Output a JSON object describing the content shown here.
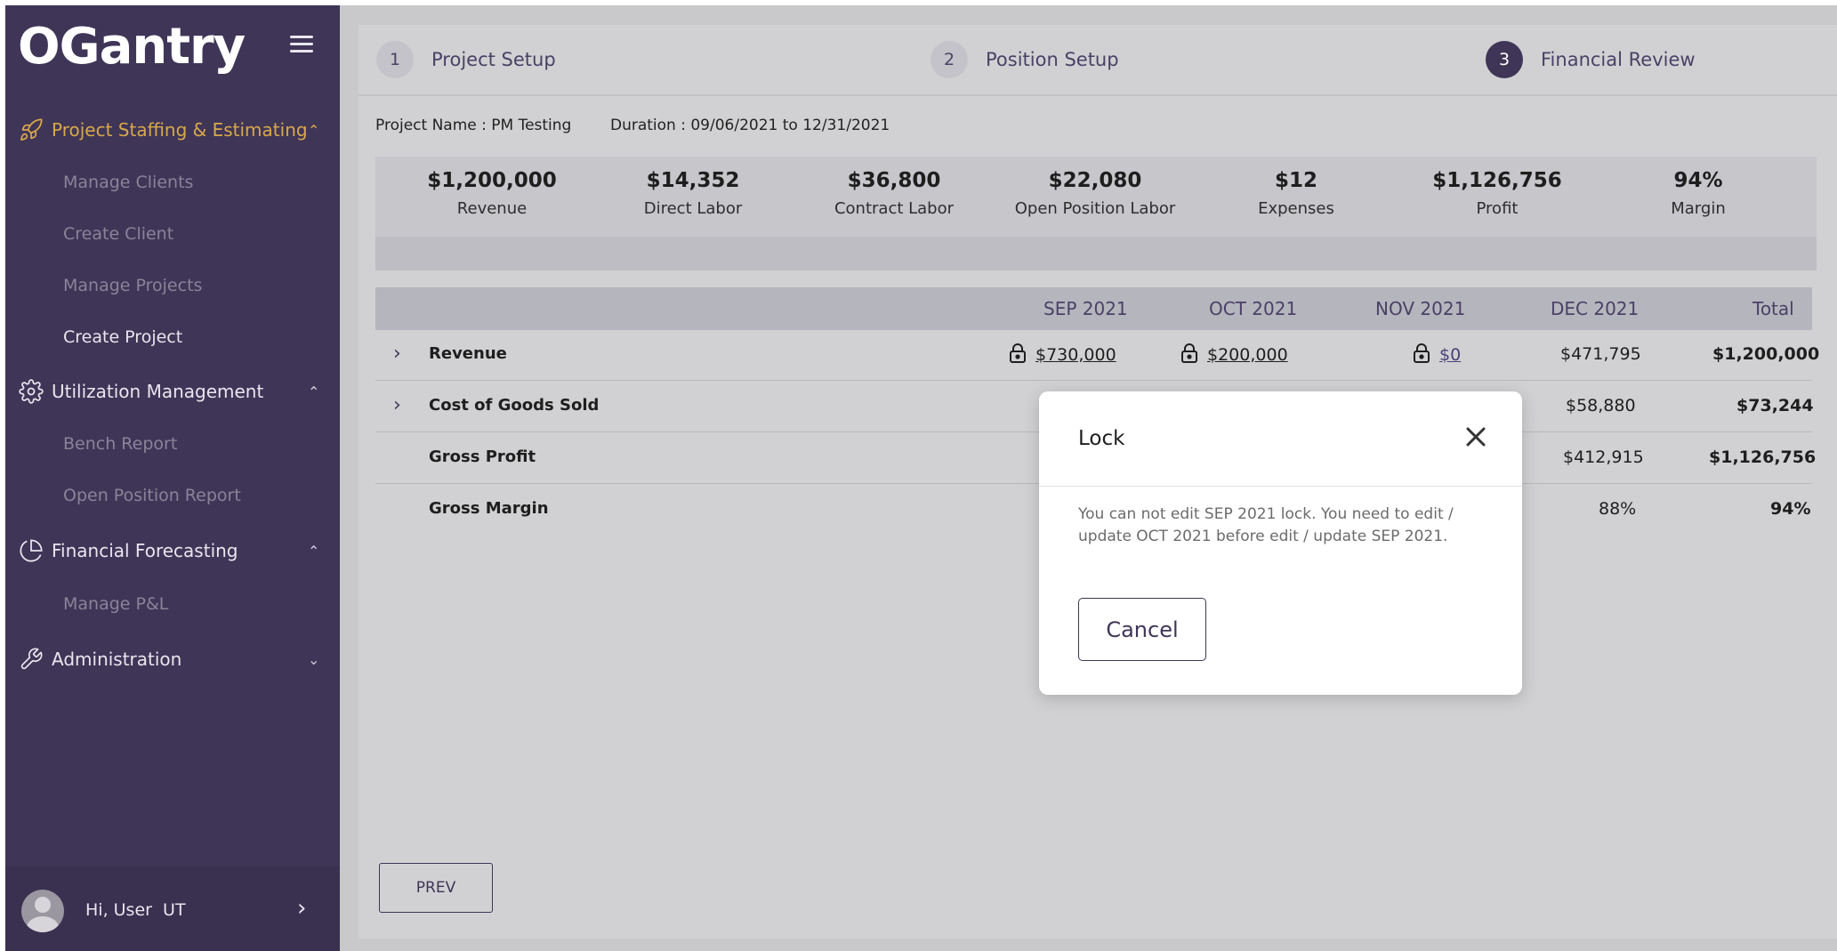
{
  "app": {
    "logo_text": "OGantry",
    "brand_color": "#3f3557",
    "accent_color": "#d8a84a"
  },
  "sidebar": {
    "sections": [
      {
        "label": "Project Staffing & Estimating",
        "icon": "rocket-icon",
        "expanded": true,
        "active": true,
        "items": [
          "Manage Clients",
          "Create Client",
          "Manage Projects",
          "Create Project"
        ]
      },
      {
        "label": "Utilization Management",
        "icon": "gear-icon",
        "expanded": true,
        "items": [
          "Bench Report",
          "Open Position Report"
        ]
      },
      {
        "label": "Financial Forecasting",
        "icon": "pie-chart-icon",
        "expanded": true,
        "items": [
          "Manage P&L"
        ]
      },
      {
        "label": "Administration",
        "icon": "wrench-icon",
        "expanded": false,
        "items": []
      }
    ],
    "current_item": "Create Project",
    "user": {
      "greeting": "Hi, User",
      "initials": "UT"
    }
  },
  "stepper": {
    "steps": [
      {
        "number": "1",
        "label": "Project Setup"
      },
      {
        "number": "2",
        "label": "Position Setup"
      },
      {
        "number": "3",
        "label": "Financial Review"
      }
    ],
    "active_step": 3
  },
  "project": {
    "name": "Project Name : PM Testing",
    "duration": "Duration : 09/06/2021 to 12/31/2021"
  },
  "summary": [
    {
      "value": "$1,200,000",
      "label": "Revenue"
    },
    {
      "value": "$14,352",
      "label": "Direct Labor"
    },
    {
      "value": "$36,800",
      "label": "Contract Labor"
    },
    {
      "value": "$22,080",
      "label": "Open Position Labor"
    },
    {
      "value": "$12",
      "label": "Expenses"
    },
    {
      "value": "$1,126,756",
      "label": "Profit"
    },
    {
      "value": "94%",
      "label": "Margin"
    }
  ],
  "table": {
    "columns": [
      "SEP 2021",
      "OCT 2021",
      "NOV 2021",
      "DEC 2021",
      "Total"
    ],
    "rows": [
      {
        "label": "Revenue",
        "expandable": true,
        "sep": "$730,000",
        "oct": "$200,000",
        "nov": "$0",
        "dec": "$471,795",
        "total": "$1,200,000",
        "locked": true
      },
      {
        "label": "Cost of Goods Sold",
        "expandable": true,
        "dec": "$58,880",
        "total": "$73,244"
      },
      {
        "label": "Gross Profit",
        "expandable": false,
        "dec": "$412,915",
        "total": "$1,126,756"
      },
      {
        "label": "Gross Margin",
        "expandable": false,
        "dec": "88%",
        "total": "94%"
      }
    ]
  },
  "buttons": {
    "prev": "PREV"
  },
  "modal": {
    "title": "Lock",
    "message": "You can not edit SEP 2021 lock. You need to edit / update OCT 2021 before edit / update SEP 2021.",
    "cancel": "Cancel"
  }
}
